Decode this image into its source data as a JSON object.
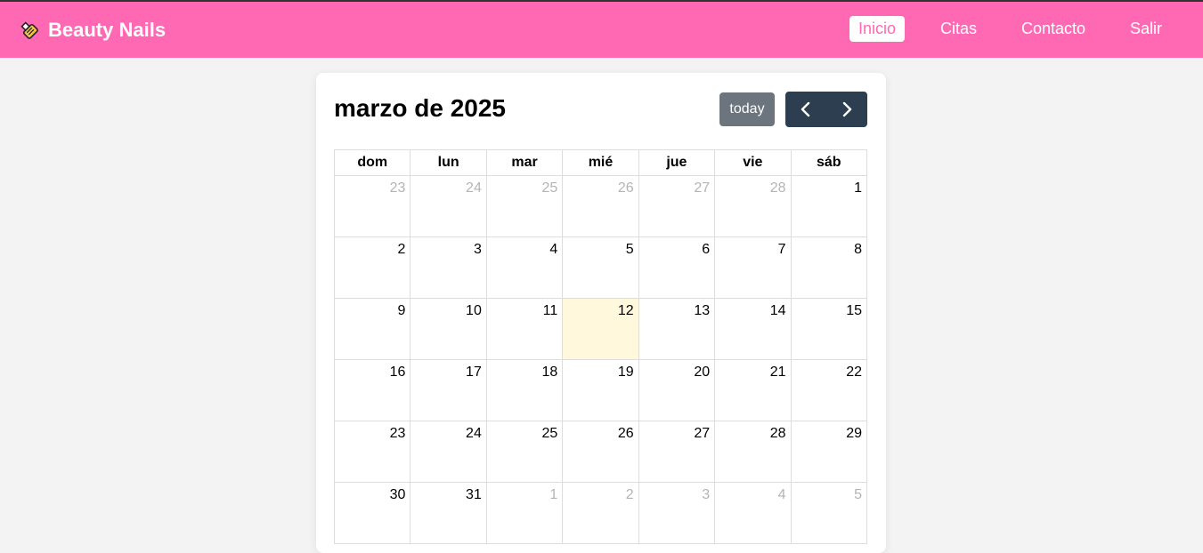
{
  "navbar": {
    "brand": "Beauty Nails",
    "brand_icon": "nail-polish-icon",
    "links": [
      {
        "label": "Inicio",
        "active": true
      },
      {
        "label": "Citas",
        "active": false
      },
      {
        "label": "Contacto",
        "active": false
      },
      {
        "label": "Salir",
        "active": false
      }
    ],
    "color": "#ff69b4"
  },
  "calendar": {
    "title": "marzo de 2025",
    "today_label": "today",
    "prev_icon": "chevron-left-icon",
    "next_icon": "chevron-right-icon",
    "weekdays": [
      "dom",
      "lun",
      "mar",
      "mié",
      "jue",
      "vie",
      "sáb"
    ],
    "weeks": [
      [
        {
          "d": "23",
          "o": true
        },
        {
          "d": "24",
          "o": true
        },
        {
          "d": "25",
          "o": true
        },
        {
          "d": "26",
          "o": true
        },
        {
          "d": "27",
          "o": true
        },
        {
          "d": "28",
          "o": true
        },
        {
          "d": "1"
        }
      ],
      [
        {
          "d": "2"
        },
        {
          "d": "3"
        },
        {
          "d": "4"
        },
        {
          "d": "5"
        },
        {
          "d": "6"
        },
        {
          "d": "7"
        },
        {
          "d": "8"
        }
      ],
      [
        {
          "d": "9"
        },
        {
          "d": "10"
        },
        {
          "d": "11"
        },
        {
          "d": "12",
          "t": true
        },
        {
          "d": "13"
        },
        {
          "d": "14"
        },
        {
          "d": "15"
        }
      ],
      [
        {
          "d": "16"
        },
        {
          "d": "17"
        },
        {
          "d": "18"
        },
        {
          "d": "19"
        },
        {
          "d": "20"
        },
        {
          "d": "21"
        },
        {
          "d": "22"
        }
      ],
      [
        {
          "d": "23"
        },
        {
          "d": "24"
        },
        {
          "d": "25"
        },
        {
          "d": "26"
        },
        {
          "d": "27"
        },
        {
          "d": "28"
        },
        {
          "d": "29"
        }
      ],
      [
        {
          "d": "30"
        },
        {
          "d": "31"
        },
        {
          "d": "1",
          "o": true
        },
        {
          "d": "2",
          "o": true
        },
        {
          "d": "3",
          "o": true
        },
        {
          "d": "4",
          "o": true
        },
        {
          "d": "5",
          "o": true
        }
      ]
    ],
    "today_highlight_color": "#fff8dc",
    "button_color": "#2c3e50"
  }
}
